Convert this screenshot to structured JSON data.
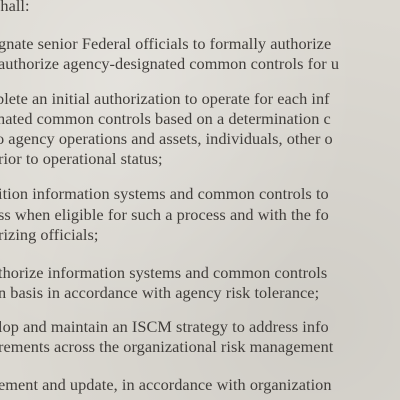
{
  "document": {
    "lines": [
      "shall:",
      "gnate senior Federal officials to formally authorize",
      "authorize agency-designated common controls for u",
      "plete an initial authorization to operate for each inf",
      "nated common controls based on a determination c",
      "o agency operations and assets, individuals, other o",
      "rior to operational status;",
      "ition information systems and common controls to",
      "ss when eligible for such a process and with the fo",
      "rizing officials;",
      "thorize information systems and common controls",
      "n basis in accordance with agency risk tolerance;",
      "lop and maintain an ISCM strategy to address info",
      "rements across the organizational risk management",
      "ement and update, in accordance with organization"
    ]
  }
}
